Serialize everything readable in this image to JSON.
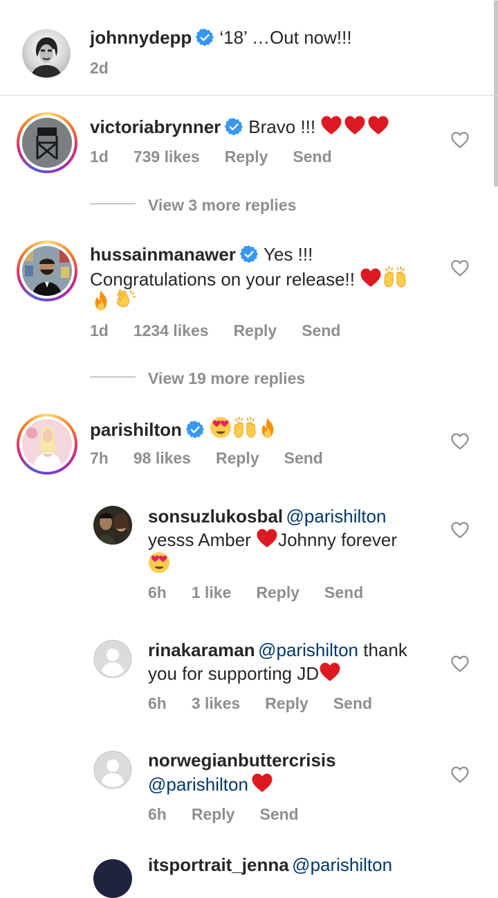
{
  "post": {
    "author": "johnnydepp",
    "caption": "‘18’ …Out now!!!",
    "time": "2d"
  },
  "comments": [
    {
      "username": "victoriabrynner",
      "text": "Bravo !!! ",
      "time": "1d",
      "likes": "739 likes",
      "reply": "Reply",
      "send": "Send",
      "view_replies": "View 3 more replies"
    },
    {
      "username": "hussainmanawer",
      "text_line1": "Yes !!!",
      "text_line2": "Congratulations on your release!! ",
      "time": "1d",
      "likes": "1234 likes",
      "reply": "Reply",
      "send": "Send",
      "view_replies": "View 19 more replies"
    },
    {
      "username": "parishilton",
      "time": "7h",
      "likes": "98 likes",
      "reply": "Reply",
      "send": "Send"
    }
  ],
  "replies": [
    {
      "username": "sonsuzlukosbal",
      "mention": "@parishilton",
      "text_line1a": "yesss Amber ",
      "text_line1b": "Johnny forever",
      "time": "6h",
      "likes": "1 like",
      "reply": "Reply",
      "send": "Send"
    },
    {
      "username": "rinakaraman",
      "mention": "@parishilton",
      "text_a": " thank",
      "text_line2": "you for supporting JD",
      "time": "6h",
      "likes": "3 likes",
      "reply": "Reply",
      "send": "Send"
    },
    {
      "username": "norwegianbuttercrisis",
      "mention": "@parishilton",
      "time": "6h",
      "reply": "Reply",
      "send": "Send"
    }
  ],
  "partial_next": {
    "username": "itsportrait_jenna",
    "mention": "@parishilton"
  },
  "colors": {
    "verified": "#3897f0",
    "heart": "#ed1c24",
    "mention": "#00376b"
  },
  "icons": [
    "verified-badge-icon",
    "heart-icon",
    "red-heart-emoji",
    "fire-emoji",
    "raised-hands-emoji",
    "clapping-hands-emoji",
    "heart-eyes-emoji",
    "default-avatar-icon"
  ]
}
